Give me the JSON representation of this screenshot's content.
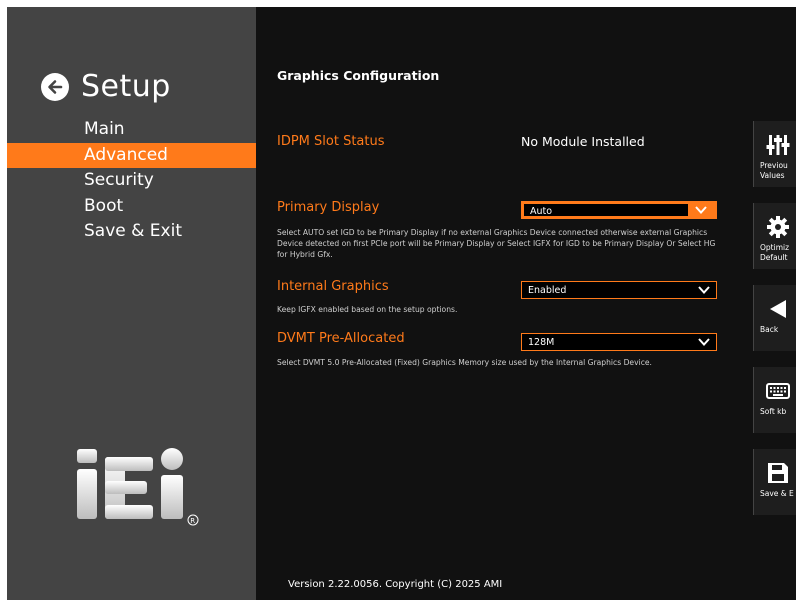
{
  "sidebar": {
    "title": "Setup",
    "items": [
      {
        "label": "Main",
        "active": false
      },
      {
        "label": "Advanced",
        "active": true
      },
      {
        "label": "Security",
        "active": false
      },
      {
        "label": "Boot",
        "active": false
      },
      {
        "label": "Save & Exit",
        "active": false
      }
    ],
    "logo_text": "iEi",
    "logo_mark": "®"
  },
  "main": {
    "page_title": "Graphics Configuration",
    "idpm": {
      "label": "IDPM Slot Status",
      "value": "No Module Installed"
    },
    "primary_display": {
      "label": "Primary Display",
      "value": "Auto",
      "help": "Select AUTO set IGD to be Primary Display if no external Graphics Device connected otherwise external Graphics Device detected on first PCIe port will be Primary Display or Select IGFX for IGD to be Primary Display Or Select HG for Hybrid Gfx."
    },
    "internal_graphics": {
      "label": "Internal Graphics",
      "value": "Enabled",
      "help": "Keep IGFX enabled based on the setup options."
    },
    "dvmt": {
      "label": "DVMT Pre-Allocated",
      "value": "128M",
      "help": "Select DVMT 5.0 Pre-Allocated (Fixed) Graphics Memory size used by the Internal Graphics Device."
    },
    "version": "Version 2.22.0056. Copyright (C) 2025 AMI"
  },
  "rightbar": {
    "previous": "Previou\nValues",
    "optimized": "Optimiz\nDefault",
    "back": "Back",
    "softkb": "Soft kb",
    "save": "Save & E"
  },
  "colors": {
    "accent": "#ff7a1a",
    "sidebar": "#444444",
    "main_bg": "#111111"
  }
}
